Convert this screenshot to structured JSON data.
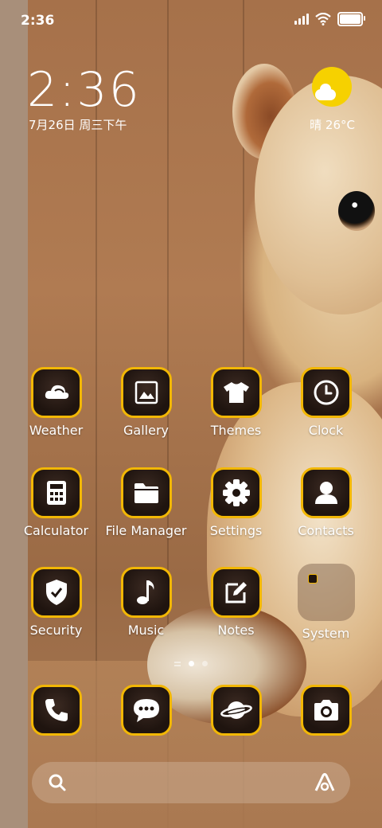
{
  "status_bar": {
    "time": "2:36",
    "icons": [
      "signal-icon",
      "wifi-icon",
      "battery-icon"
    ]
  },
  "widget": {
    "time": "2:36",
    "date": "7月26日 周三下午",
    "weather": "晴 26°C",
    "weather_icon": "sun-cloud-icon"
  },
  "accent_color": "#f2b705",
  "apps": [
    {
      "label": "Weather",
      "icon": "weather-icon"
    },
    {
      "label": "Gallery",
      "icon": "gallery-icon"
    },
    {
      "label": "Themes",
      "icon": "tshirt-icon"
    },
    {
      "label": "Clock",
      "icon": "clock-icon"
    },
    {
      "label": "Calculator",
      "icon": "calculator-icon"
    },
    {
      "label": "File Manager",
      "icon": "folder-icon"
    },
    {
      "label": "Settings",
      "icon": "gear-icon"
    },
    {
      "label": "Contacts",
      "icon": "person-icon"
    },
    {
      "label": "Security",
      "icon": "shield-icon"
    },
    {
      "label": "Music",
      "icon": "music-note-icon"
    },
    {
      "label": "Notes",
      "icon": "note-pencil-icon"
    },
    {
      "label": "System",
      "icon": "folder-icon"
    }
  ],
  "dock": [
    {
      "name": "phone",
      "icon": "phone-icon"
    },
    {
      "name": "messages",
      "icon": "chat-icon"
    },
    {
      "name": "browser",
      "icon": "planet-icon"
    },
    {
      "name": "camera",
      "icon": "camera-icon"
    }
  ],
  "pages": {
    "count": 2,
    "current": 1
  },
  "search": {
    "icons": [
      "search-icon",
      "assistant-icon"
    ]
  }
}
